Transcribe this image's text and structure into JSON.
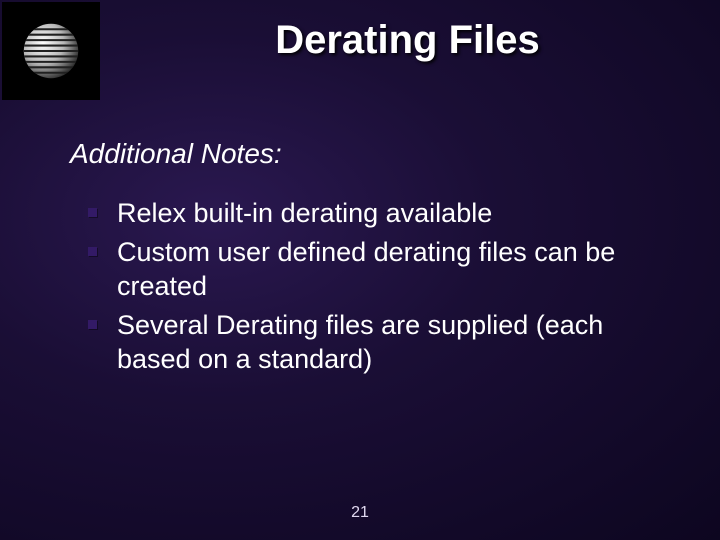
{
  "slide": {
    "title": "Derating Files",
    "subtitle": "Additional Notes:",
    "bullets": [
      "Relex built-in derating available",
      "Custom user defined derating files can be created",
      "Several Derating files are supplied (each based on a standard)"
    ],
    "page_number": "21"
  }
}
